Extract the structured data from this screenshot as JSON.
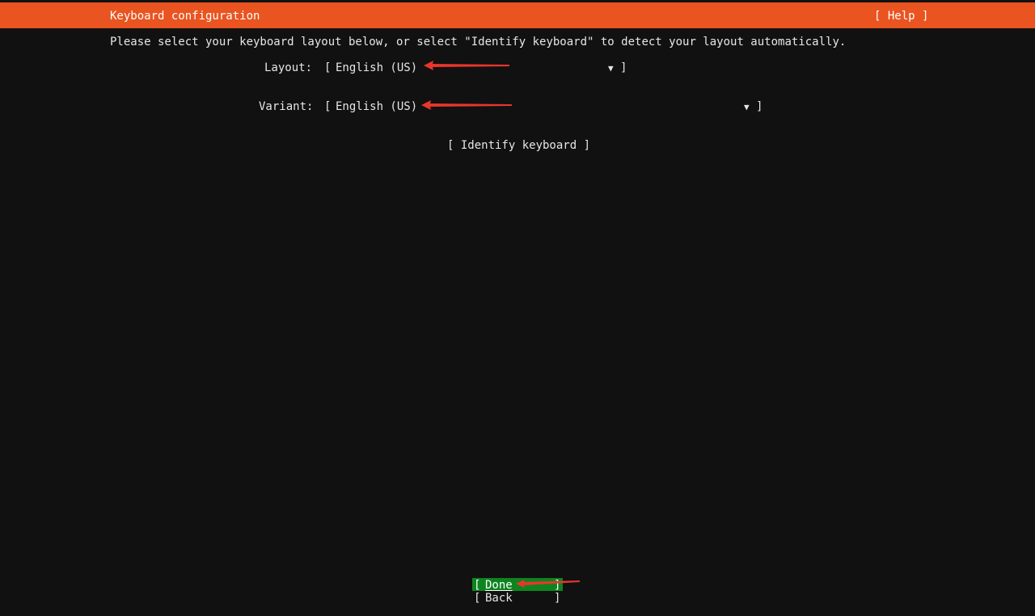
{
  "header": {
    "title": "Keyboard configuration",
    "help_label": "[ Help ]"
  },
  "instruction": "Please select your keyboard layout below, or select \"Identify keyboard\" to detect your layout automatically.",
  "layout": {
    "label": "Layout:",
    "value": "English (US)",
    "caret_icon": "triangle-down-icon"
  },
  "variant": {
    "label": "Variant:",
    "value": "English (US)",
    "caret_icon": "triangle-down-icon"
  },
  "identify_button": "[ Identify keyboard ]",
  "done_button": "Done",
  "back_button": "Back",
  "colors": {
    "background": "#111111",
    "header": "#e95420",
    "done_highlight": "#0e8420",
    "annotation_arrow": "#e8362c",
    "text": "#e6e6e6"
  }
}
